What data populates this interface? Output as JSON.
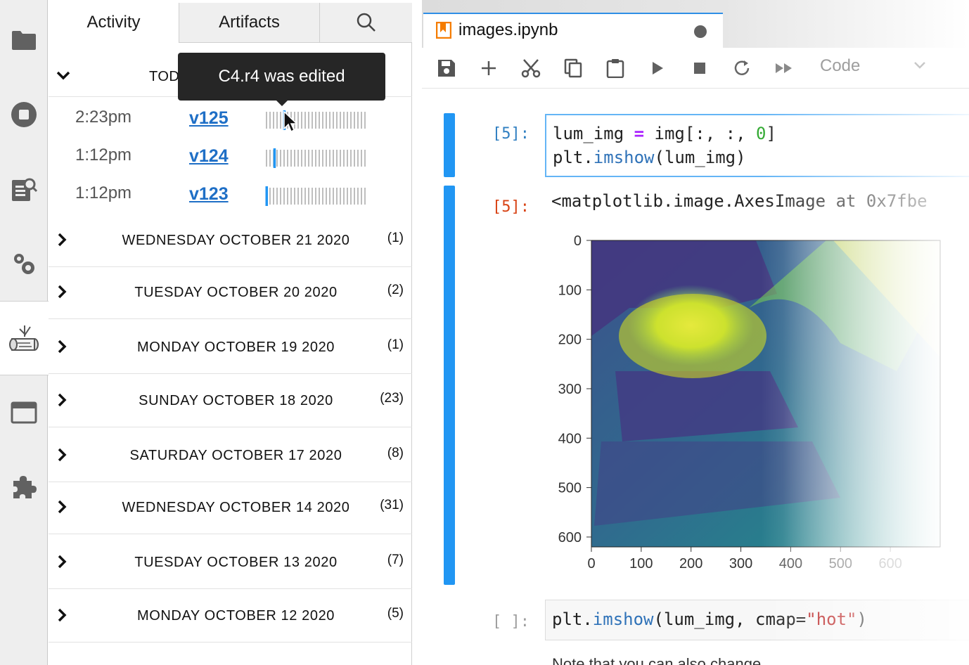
{
  "rail": {
    "items": [
      {
        "icon": "folder-icon",
        "active": false
      },
      {
        "icon": "stop-circle-icon",
        "active": false
      },
      {
        "icon": "property-inspector-icon",
        "active": false
      },
      {
        "icon": "settings-gears-icon",
        "active": false
      },
      {
        "icon": "log-history-icon",
        "active": true
      },
      {
        "icon": "tabs-window-icon",
        "active": false
      },
      {
        "icon": "extension-puzzle-icon",
        "active": false
      }
    ]
  },
  "panel": {
    "tabs": {
      "activity": "Activity",
      "artifacts": "Artifacts",
      "search_icon": "search-icon"
    },
    "today_label": "TOD",
    "versions": [
      {
        "time": "2:23pm",
        "version": "v125",
        "marker_fraction": 0.18,
        "highlight": true
      },
      {
        "time": "1:12pm",
        "version": "v124",
        "marker_fraction": 0.08,
        "highlight": false
      },
      {
        "time": "1:12pm",
        "version": "v123",
        "marker_fraction": 0.0,
        "highlight": false
      }
    ],
    "days": [
      {
        "label": "WEDNESDAY OCTOBER 21 2020",
        "count": "(1)"
      },
      {
        "label": "TUESDAY OCTOBER 20 2020",
        "count": "(2)"
      },
      {
        "label": "MONDAY OCTOBER 19 2020",
        "count": "(1)"
      },
      {
        "label": "SUNDAY OCTOBER 18 2020",
        "count": "(23)"
      },
      {
        "label": "SATURDAY OCTOBER 17 2020",
        "count": "(8)"
      },
      {
        "label": "WEDNESDAY OCTOBER 14 2020",
        "count": "(31)"
      },
      {
        "label": "TUESDAY OCTOBER 13 2020",
        "count": "(7)"
      },
      {
        "label": "MONDAY OCTOBER 12 2020",
        "count": "(5)"
      }
    ],
    "tooltip": "C4.r4 was edited"
  },
  "notebook": {
    "filename": "images.ipynb",
    "toolbar": {
      "buttons": [
        "save-icon",
        "add-icon",
        "cut-icon",
        "copy-icon",
        "paste-icon",
        "run-icon",
        "stop-icon",
        "restart-icon",
        "fast-forward-icon"
      ],
      "cell_type": "Code"
    },
    "cells": [
      {
        "prompt": "[5]:",
        "code_line1_a": "lum_img ",
        "code_line1_op": "=",
        "code_line1_b": " img[:, :, ",
        "code_line1_num": "0",
        "code_line1_c": "]",
        "code_line2_a": "plt.",
        "code_line2_fn": "imshow",
        "code_line2_b": "(lum_img)"
      },
      {
        "prompt": "[5]:",
        "output": "<matplotlib.image.AxesImage at 0x7fbe"
      },
      {
        "prompt": "[ ]:",
        "code_a": "plt.",
        "code_fn": "imshow",
        "code_b": "(lum_img, cmap=",
        "code_str": "\"hot\"",
        "code_c": ")"
      }
    ],
    "next_markdown": "Note that you can also change colormaps"
  },
  "chart_data": {
    "type": "heatmap",
    "x_ticks": [
      "0",
      "100",
      "200",
      "300",
      "400",
      "500",
      "600"
    ],
    "y_ticks": [
      "0",
      "100",
      "200",
      "300",
      "400",
      "500",
      "600"
    ],
    "xlim": [
      0,
      700
    ],
    "ylim": [
      620,
      0
    ],
    "colormap": "viridis"
  }
}
